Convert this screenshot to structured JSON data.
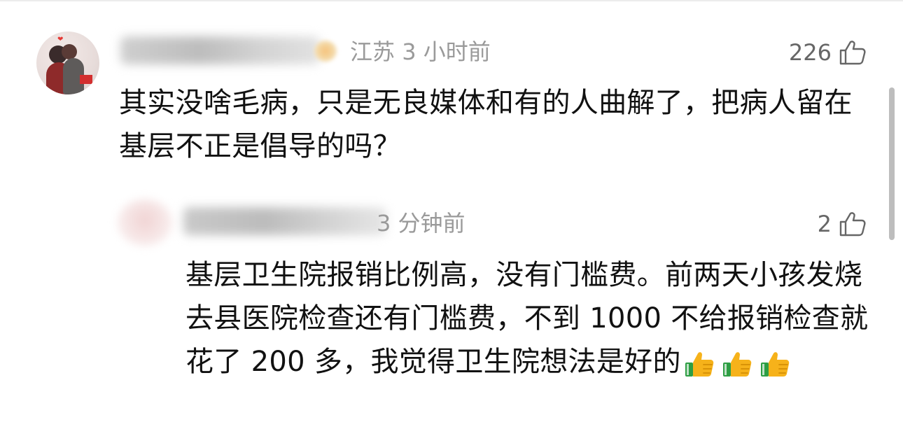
{
  "comments": [
    {
      "location": "江苏",
      "time": "3 小时前",
      "likes": "226",
      "text": "其实没啥毛病，只是无良媒体和有的人曲解了，把病人留在基层不正是倡导的吗？"
    },
    {
      "time": "3 分钟前",
      "likes": "2",
      "text": "基层卫生院报销比例高，没有门槛费。前两天小孩发烧去县医院检查还有门槛费，不到 1000 不给报销检查就花了 200 多，我觉得卫生院想法是好的",
      "emojis": [
        "thumbs-up-icon",
        "thumbs-up-icon",
        "thumbs-up-icon"
      ]
    }
  ],
  "colors": {
    "meta_text": "#9a9a9a",
    "like_text": "#666666",
    "body_text": "#111111",
    "emoji_hand": "#f6b21a",
    "emoji_sleeve": "#2e9e44"
  }
}
